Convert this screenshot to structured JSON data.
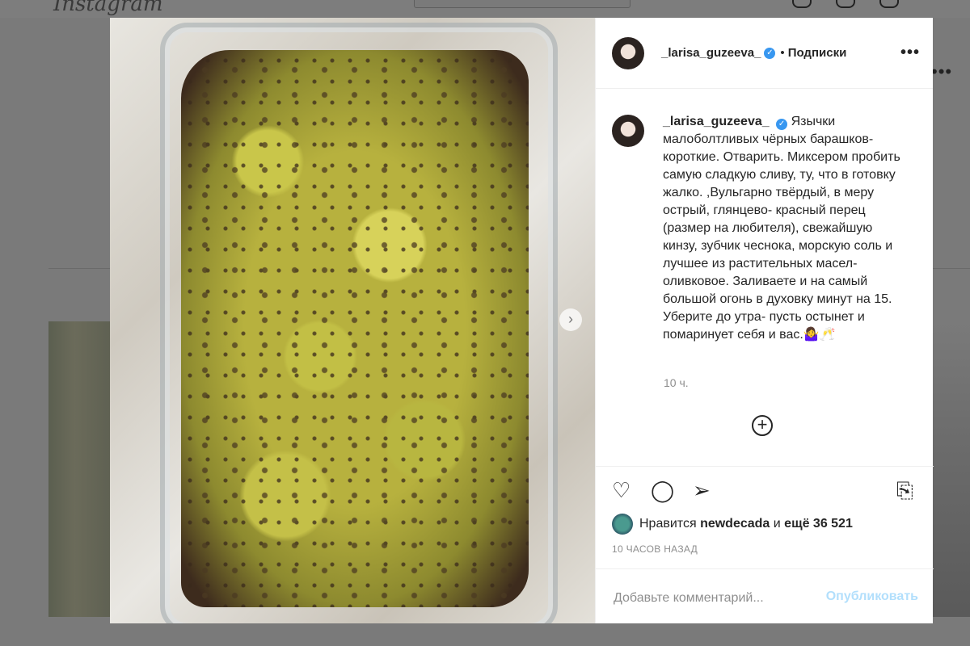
{
  "background": {
    "logo": "Instagram"
  },
  "post": {
    "author": "_larisa_guzeeva_",
    "follow_separator": "•",
    "follow_label": "Подписки",
    "more_label": "•••",
    "caption": "Язычки малоболтливых чёрных барашков- короткие. Отварить. Миксером пробить самую сладкую сливу, ту, что в готовку жалко. ,Вульгарно твёрдый, в меру острый, глянцево- красный перец (размер на любителя), свежайшую кинзу, зубчик чеснока, морскую соль и лучшее из растительных масел- оливковое. Заливаете и на самый большой огонь в духовку минут на 15. Уберите до утра- пусть остынет и помаринует себя и вас.🤷‍♀️🥂",
    "caption_time": "10 ч.",
    "likes_prefix": "Нравится",
    "likes_user": "newdecada",
    "likes_middle": "и",
    "likes_more": "ещё 36 521",
    "posted_ago": "10 ЧАСОВ НАЗАД",
    "comment_placeholder": "Добавьте комментарий...",
    "publish_label": "Опубликовать"
  },
  "icons": {
    "verified": "verified-badge-icon",
    "like": "heart-icon",
    "comment": "comment-icon",
    "share": "share-icon",
    "save": "bookmark-icon",
    "add": "plus-circle-icon",
    "next": "chevron-right-icon"
  },
  "colors": {
    "accent": "#3897f0",
    "publish_disabled": "#b2dffc",
    "text": "#262626",
    "muted": "#8e8e8e"
  }
}
